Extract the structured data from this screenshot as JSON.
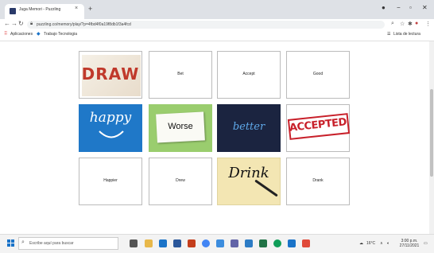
{
  "browser": {
    "tab_title": "Juga Memori - Puzzling",
    "tab_close": "×",
    "new_tab": "+",
    "url": "puzzling.co/memory/play/?p=4fbd4f0a19f8db1f3a4fcd",
    "bookmarks": [
      "Aplicaciones",
      "Trabajo Tecnologia"
    ],
    "reading_list": "Lista de lectura"
  },
  "cards": [
    {
      "label": "DRAW",
      "kind": "image"
    },
    {
      "label": "Bet",
      "kind": "text"
    },
    {
      "label": "Accept",
      "kind": "text"
    },
    {
      "label": "Good",
      "kind": "text"
    },
    {
      "label": "happy",
      "kind": "image"
    },
    {
      "label": "Worse",
      "kind": "image"
    },
    {
      "label": "better",
      "kind": "image"
    },
    {
      "label": "ACCEPTED",
      "kind": "image"
    },
    {
      "label": "Happier",
      "kind": "text"
    },
    {
      "label": "Drew",
      "kind": "text"
    },
    {
      "label": "Drink",
      "kind": "image"
    },
    {
      "label": "Drank",
      "kind": "text"
    }
  ],
  "taskbar": {
    "search_placeholder": "Escribe aquí para buscar",
    "weather": "16°C",
    "time": "3:00 p.m.",
    "date": "27/11/2021"
  },
  "colors": {
    "happy_bg": "#1f78c8",
    "better_bg": "#1b2440",
    "accepted_red": "#c8202a",
    "worse_bg": "#9acd6e",
    "drink_bg": "#f3e6b3"
  }
}
